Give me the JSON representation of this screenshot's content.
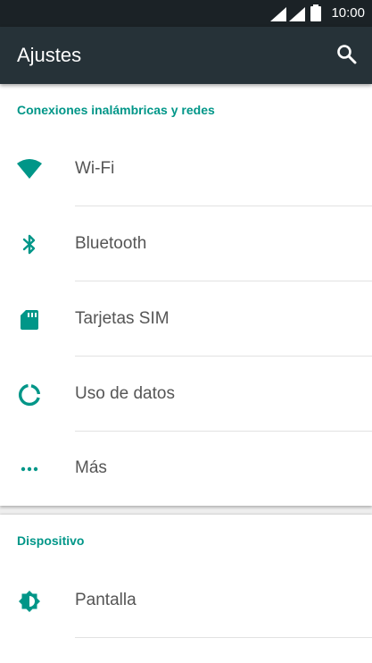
{
  "status_bar": {
    "time": "10:00",
    "icons": [
      "wifi-signal-icon",
      "cell-signal-icon",
      "battery-icon"
    ]
  },
  "app_bar": {
    "title": "Ajustes",
    "search_icon": "search-icon"
  },
  "colors": {
    "status_bar_bg": "#1b2226",
    "app_bar_bg": "#263238",
    "accent": "#009688",
    "label_text": "#555555",
    "background": "#eeeeee"
  },
  "sections": [
    {
      "header": "Conexiones inalámbricas y redes",
      "items": [
        {
          "label": "Wi-Fi",
          "icon": "wifi-icon"
        },
        {
          "label": "Bluetooth",
          "icon": "bluetooth-icon"
        },
        {
          "label": "Tarjetas SIM",
          "icon": "sim-card-icon"
        },
        {
          "label": "Uso de datos",
          "icon": "data-usage-icon"
        },
        {
          "label": "Más",
          "icon": "more-dots-icon"
        }
      ]
    },
    {
      "header": "Dispositivo",
      "items": [
        {
          "label": "Pantalla",
          "icon": "brightness-icon"
        }
      ]
    }
  ]
}
